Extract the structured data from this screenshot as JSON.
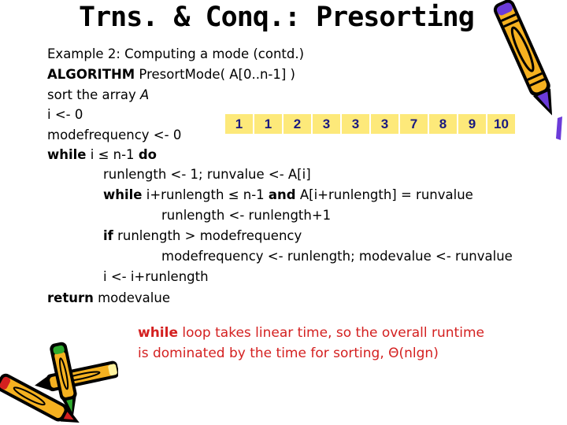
{
  "slide": {
    "title": "Trns. & Conq.: Presorting",
    "code_lines": [
      {
        "indent": 0,
        "parts": [
          {
            "text": "Example 2: Computing a mode (contd.)",
            "style": "normal"
          }
        ]
      },
      {
        "indent": 0,
        "parts": [
          {
            "text": "ALGORITHM",
            "style": "bold"
          },
          {
            "text": " PresortMode( A[0..n-1] )",
            "style": "normal"
          }
        ]
      },
      {
        "indent": 0,
        "parts": [
          {
            "text": "sort the array ",
            "style": "normal"
          },
          {
            "text": "A",
            "style": "italic"
          }
        ]
      },
      {
        "indent": 0,
        "parts": [
          {
            "text": "i <- 0",
            "style": "normal"
          }
        ]
      },
      {
        "indent": 0,
        "parts": [
          {
            "text": "modefrequency <- 0",
            "style": "normal"
          }
        ]
      },
      {
        "indent": 0,
        "parts": [
          {
            "text": "while",
            "style": "bold"
          },
          {
            "text": " i ≤ n-1 ",
            "style": "normal"
          },
          {
            "text": "do",
            "style": "bold"
          }
        ]
      },
      {
        "indent": 1,
        "parts": [
          {
            "text": "runlength <- 1; runvalue <- A[i]",
            "style": "normal"
          }
        ]
      },
      {
        "indent": 1,
        "parts": [
          {
            "text": "while",
            "style": "bold"
          },
          {
            "text": " i+runlength ≤ n-1 ",
            "style": "normal"
          },
          {
            "text": "and",
            "style": "bold"
          },
          {
            "text": " A[i+runlength] = runvalue",
            "style": "normal"
          }
        ]
      },
      {
        "indent": 2,
        "parts": [
          {
            "text": "runlength <- runlength+1",
            "style": "normal"
          }
        ]
      },
      {
        "indent": 1,
        "parts": [
          {
            "text": "if",
            "style": "bold"
          },
          {
            "text": " runlength > modefrequency",
            "style": "normal"
          }
        ]
      },
      {
        "indent": 2,
        "parts": [
          {
            "text": "modefrequency <- runlength; modevalue <- runvalue",
            "style": "normal"
          }
        ]
      },
      {
        "indent": 1,
        "parts": [
          {
            "text": "i <- i+runlength",
            "style": "normal"
          }
        ]
      },
      {
        "indent": 0,
        "parts": [
          {
            "text": "return",
            "style": "bold"
          },
          {
            "text": " modevalue",
            "style": "normal"
          }
        ]
      }
    ],
    "sorted_array": [
      "1",
      "1",
      "2",
      "3",
      "3",
      "3",
      "7",
      "8",
      "9",
      "10"
    ],
    "note": {
      "keyword": "while",
      "line1_rest": " loop takes linear time, so the overall runtime",
      "line2": "is dominated by the time for sorting, Θ(nlgn)"
    },
    "colors": {
      "cell_bg": "#fde97a",
      "cell_text": "#1a1a80",
      "note_text": "#d42020"
    },
    "icons": {
      "top_right": "crayon-icon",
      "bottom_left": "crossed-crayons-icon"
    }
  }
}
